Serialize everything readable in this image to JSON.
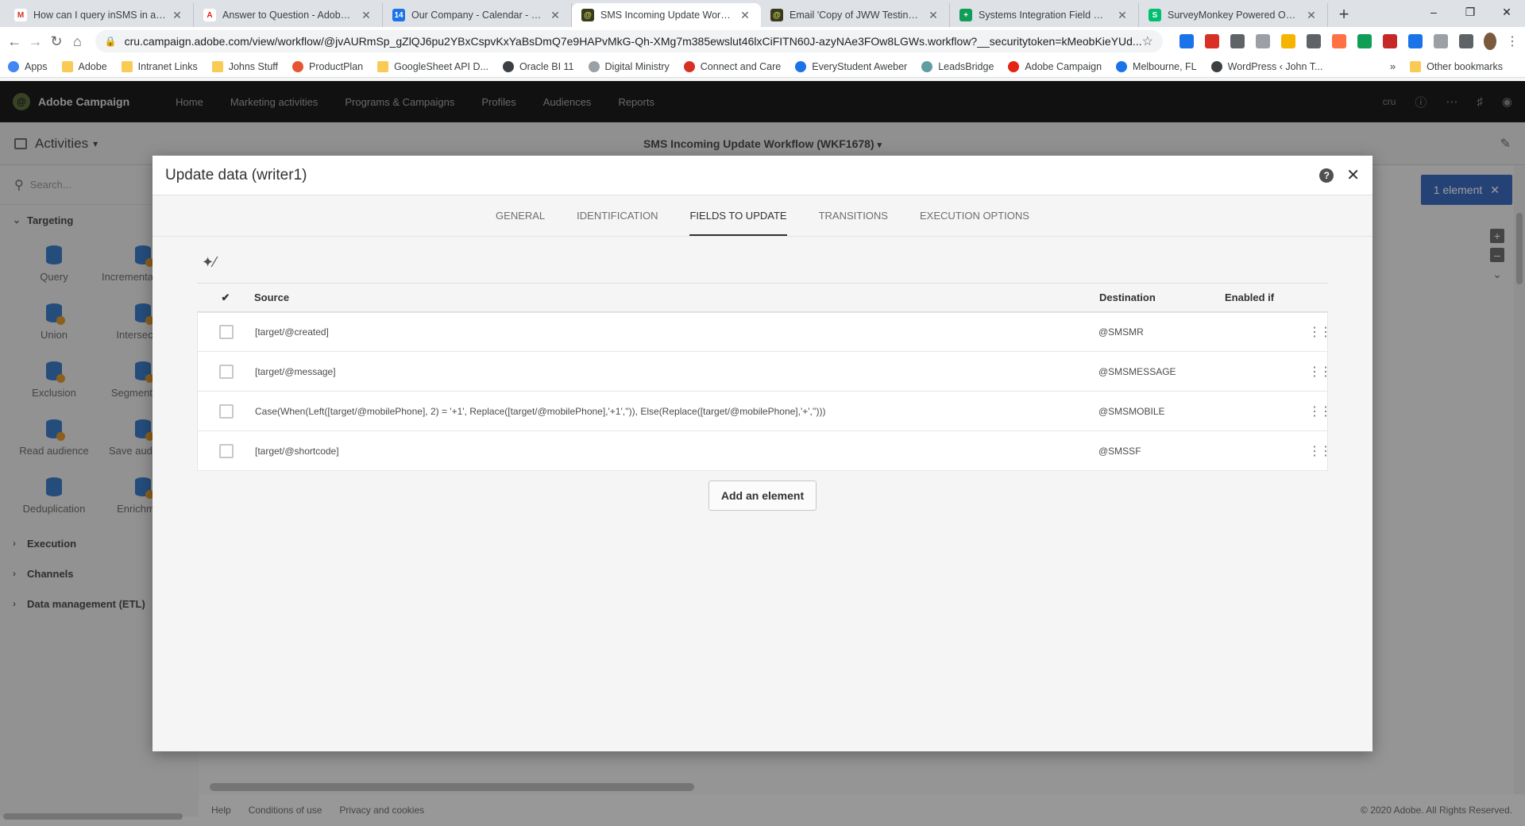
{
  "browser": {
    "tabs": [
      {
        "title": "How can I query inSMS in a techn",
        "icon_color": "#ffffff",
        "icon_text": "M",
        "icon_text_color": "#d93025",
        "active": false
      },
      {
        "title": "Answer to Question - Adobe Exp",
        "icon_color": "#ffffff",
        "icon_text": "A",
        "icon_text_color": "#e42313",
        "active": false
      },
      {
        "title": "Our Company - Calendar - Week",
        "icon_color": "#1a73e8",
        "icon_text": "14",
        "icon_text_color": "#ffffff",
        "active": false
      },
      {
        "title": "SMS Incoming Update Workflow",
        "icon_color": "#3a3a1c",
        "icon_text": "@",
        "icon_text_color": "#c8d35b",
        "active": true
      },
      {
        "title": "Email 'Copy of JWW Testing - I Sh",
        "icon_color": "#3a3a1c",
        "icon_text": "@",
        "icon_text_color": "#c8d35b",
        "active": false
      },
      {
        "title": "Systems Integration Field Mappin",
        "icon_color": "#0f9d58",
        "icon_text": "+",
        "icon_text_color": "#ffffff",
        "active": false
      },
      {
        "title": "SurveyMonkey Powered Online S",
        "icon_color": "#00bf6f",
        "icon_text": "S",
        "icon_text_color": "#ffffff",
        "active": false
      }
    ],
    "url": "cru.campaign.adobe.com/view/workflow/@jvAURmSp_gZlQJ6pu2YBxCspvKxYaBsDmQ7e9HAPvMkG-Qh-XMg7m385ewslut46lxCiFITN60J-azyNAe3FOw8LGWs.workflow?__securitytoken=kMeobKieYUd...",
    "bookmarks": [
      {
        "label": "Apps",
        "type": "apps",
        "color": "#4285f4"
      },
      {
        "label": "Adobe",
        "type": "folder",
        "color": "#f9cb55"
      },
      {
        "label": "Intranet Links",
        "type": "folder",
        "color": "#f9cb55"
      },
      {
        "label": "Johns Stuff",
        "type": "folder",
        "color": "#f9cb55"
      },
      {
        "label": "ProductPlan",
        "type": "site",
        "color": "#e8542f"
      },
      {
        "label": "GoogleSheet API D...",
        "type": "folder",
        "color": "#f9cb55"
      },
      {
        "label": "Oracle BI 11",
        "type": "site",
        "color": "#3c4043"
      },
      {
        "label": "Digital Ministry",
        "type": "site",
        "color": "#9aa0a6"
      },
      {
        "label": "Connect and Care",
        "type": "site",
        "color": "#d93025"
      },
      {
        "label": "EveryStudent Aweber",
        "type": "site",
        "color": "#1a73e8"
      },
      {
        "label": "LeadsBridge",
        "type": "site",
        "color": "#5f9ea0"
      },
      {
        "label": "Adobe Campaign",
        "type": "site",
        "color": "#e42313"
      },
      {
        "label": "Melbourne, FL",
        "type": "site",
        "color": "#1a73e8"
      },
      {
        "label": "WordPress ‹ John T...",
        "type": "site",
        "color": "#3c4043"
      }
    ],
    "more_bookmarks": "»",
    "other_bookmarks": "Other bookmarks",
    "extension_colors": [
      "#1a73e8",
      "#d93025",
      "#5f6368",
      "#9aa0a6",
      "#f4b400",
      "#5f6368",
      "#ff7043",
      "#0f9d58",
      "#c62828",
      "#1a73e8",
      "#9aa0a6",
      "#5f6368"
    ]
  },
  "app": {
    "name": "Adobe Campaign",
    "nav": [
      "Home",
      "Marketing activities",
      "Programs & Campaigns",
      "Profiles",
      "Audiences",
      "Reports"
    ],
    "user_label": "cru",
    "workflow_title": "SMS Incoming Update Workflow (WKF1678)",
    "activities_label": "Activities",
    "search_placeholder": "Search...",
    "categories": {
      "targeting": "Targeting",
      "execution": "Execution",
      "channels": "Channels",
      "data_management": "Data management (ETL)"
    },
    "activities": [
      {
        "label": "Query",
        "icon": "query-icon",
        "badge": false
      },
      {
        "label": "Incremental query",
        "icon": "incremental-query-icon",
        "badge": true
      },
      {
        "label": "Union",
        "icon": "union-icon",
        "badge": true
      },
      {
        "label": "Intersection",
        "icon": "intersection-icon",
        "badge": true
      },
      {
        "label": "Exclusion",
        "icon": "exclusion-icon",
        "badge": true
      },
      {
        "label": "Segmentation",
        "icon": "segmentation-icon",
        "badge": true
      },
      {
        "label": "Read audience",
        "icon": "read-audience-icon",
        "badge": true
      },
      {
        "label": "Save audience",
        "icon": "save-audience-icon",
        "badge": true
      },
      {
        "label": "Deduplication",
        "icon": "deduplication-icon",
        "badge": false
      },
      {
        "label": "Enrichment",
        "icon": "enrichment-icon",
        "badge": true
      }
    ],
    "selection_pill": "1 element",
    "footer": {
      "links": [
        "Help",
        "Conditions of use",
        "Privacy and cookies"
      ],
      "copyright": "© 2020 Adobe. All Rights Reserved."
    }
  },
  "dialog": {
    "title": "Update data (writer1)",
    "tabs": [
      {
        "label": "General",
        "active": false
      },
      {
        "label": "Identification",
        "active": false
      },
      {
        "label": "Fields to update",
        "active": true
      },
      {
        "label": "Transitions",
        "active": false
      },
      {
        "label": "Execution options",
        "active": false
      }
    ],
    "columns": {
      "source": "Source",
      "destination": "Destination",
      "enabled_if": "Enabled if"
    },
    "rows": [
      {
        "source": "[target/@created]",
        "destination": "@SMSMR",
        "enabled_if": ""
      },
      {
        "source": "[target/@message]",
        "destination": "@SMSMESSAGE",
        "enabled_if": ""
      },
      {
        "source": "Case(When(Left([target/@mobilePhone], 2) = '+1', Replace([target/@mobilePhone],'+1','')), Else(Replace([target/@mobilePhone],'+','')))",
        "destination": "@SMSMOBILE",
        "enabled_if": ""
      },
      {
        "source": "[target/@shortcode]",
        "destination": "@SMSSF",
        "enabled_if": ""
      }
    ],
    "add_button": "Add an element"
  }
}
